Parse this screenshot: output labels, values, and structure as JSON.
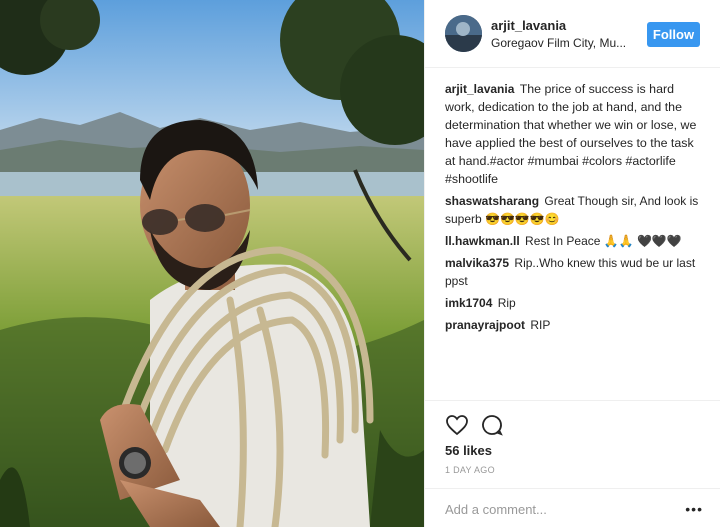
{
  "post": {
    "username": "arjit_lavania",
    "location": "Goregaov Film City, Mu...",
    "follow_label": "Follow",
    "caption": {
      "user": "arjit_lavania",
      "text": "The price of success is hard work, dedication to the job at hand, and the determination that whether we win or lose, we have applied the best of ourselves to the task at hand.#actor #mumbai #colors #actorlife #shootlife"
    },
    "comments": [
      {
        "user": "shaswatsharang",
        "text": "Great Though sir, And look is superb 😎😎😎😎😊"
      },
      {
        "user": "ll.hawkman.ll",
        "text": "Rest In Peace 🙏🙏 🖤🖤🖤"
      },
      {
        "user": "malvika375",
        "text": "Rip..Who knew this wud be ur last ppst"
      },
      {
        "user": "imk1704",
        "text": "Rip"
      },
      {
        "user": "pranayrajpoot",
        "text": "RIP"
      }
    ],
    "likes": "56 likes",
    "time": "1 DAY AGO",
    "add_comment_placeholder": "Add a comment...",
    "more_label": "•••"
  },
  "icons": {
    "heart": "heart-icon",
    "comment": "comment-icon",
    "options": "more-options-icon"
  },
  "colors": {
    "accent": "#3897f0",
    "text": "#262626",
    "muted": "#999999",
    "border": "#efefef"
  }
}
